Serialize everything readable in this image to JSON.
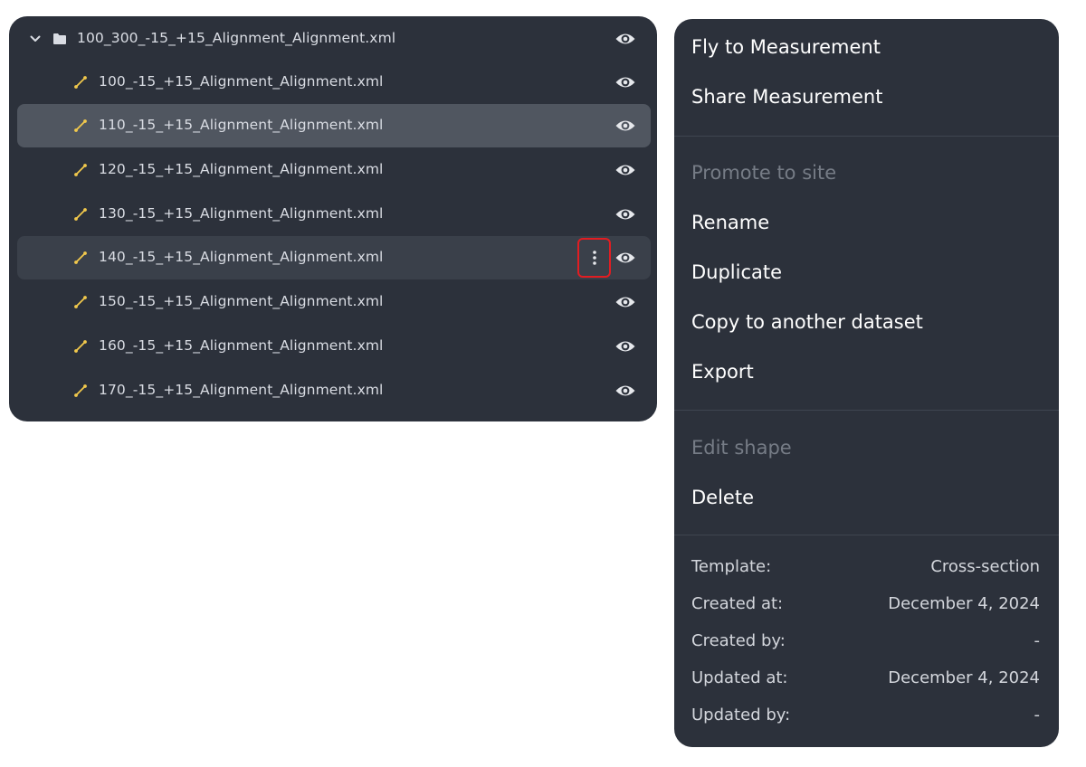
{
  "tree": {
    "folder": {
      "label": "100_300_-15_+15_Alignment_Alignment.xml"
    },
    "items": [
      {
        "label": "100_-15_+15_Alignment_Alignment.xml"
      },
      {
        "label": "110_-15_+15_Alignment_Alignment.xml"
      },
      {
        "label": "120_-15_+15_Alignment_Alignment.xml"
      },
      {
        "label": "130_-15_+15_Alignment_Alignment.xml"
      },
      {
        "label": "140_-15_+15_Alignment_Alignment.xml"
      },
      {
        "label": "150_-15_+15_Alignment_Alignment.xml"
      },
      {
        "label": "160_-15_+15_Alignment_Alignment.xml"
      },
      {
        "label": "170_-15_+15_Alignment_Alignment.xml"
      }
    ],
    "selected_index": 1,
    "hovered_index": 4,
    "icons": {
      "folder_chevron": "chevron-down-icon",
      "folder": "folder-icon",
      "item": "polyline-measurement-icon",
      "visibility": "eye-icon",
      "more": "more-vertical-icon"
    }
  },
  "menu": {
    "fly_to": "Fly to Measurement",
    "share": "Share Measurement",
    "promote": "Promote to site",
    "rename": "Rename",
    "duplicate": "Duplicate",
    "copy": "Copy to another dataset",
    "export": "Export",
    "edit_shape": "Edit shape",
    "delete": "Delete"
  },
  "metadata": {
    "template_label": "Template:",
    "template_value": "Cross-section",
    "created_at_label": "Created at:",
    "created_at_value": "December 4, 2024",
    "created_by_label": "Created by:",
    "created_by_value": "-",
    "updated_at_label": "Updated at:",
    "updated_at_value": "December 4, 2024",
    "updated_by_label": "Updated by:",
    "updated_by_value": "-"
  },
  "colors": {
    "panel_bg": "#2c313b",
    "selected_row": "#505660",
    "hover_row": "#3a404a",
    "measurement_icon": "#f2c94c",
    "highlight_outline": "#e11d22",
    "disabled_text": "#767c86"
  }
}
